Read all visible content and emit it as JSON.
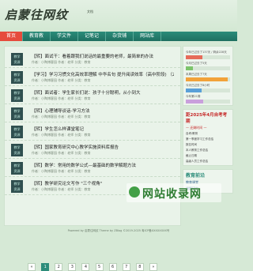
{
  "header": {
    "logo_text": "启蒙往网纹",
    "logo_sub": "文档"
  },
  "nav": {
    "items": [
      "首页",
      "教育教",
      "学文件",
      "记笔记",
      "杂货铺",
      "网站库"
    ],
    "active_index": 0
  },
  "articles": [
    {
      "badge": "教学\n资源",
      "title": "【转】面试干：看着跟我们说话的最重要的老师，最简单的办法",
      "meta": "作者：小陶博客园 作者：老师 分类：教育",
      "stamp": ""
    },
    {
      "badge": "教学\n资源",
      "title": "【学习】学习习惯文化高效率理解 中华名句 提升阅读效率（高中阶段) （2024—2025年）",
      "meta": "作者：小陶博客园 作者：老师 分类：教育",
      "stamp": ""
    },
    {
      "badge": "教学\n资源",
      "title": "【转】面试者：学生家长们说：孩子十分聪明，从小到大",
      "meta": "作者：小陶博客园 作者：老师 分类：教育",
      "stamp": ""
    },
    {
      "badge": "教学\n资源",
      "title": "【转】心理辅导谈话-学习方法",
      "meta": "作者：小陶博客园 作者：老师 分类：教育",
      "stamp": ""
    },
    {
      "badge": "教学\n资源",
      "title": "【转】学生怎么样课堂笔记",
      "meta": "作者：小陶博客园 作者：老师 分类：教育",
      "stamp": ""
    },
    {
      "badge": "教学\n资源",
      "title": "【转】国家教育研究中心教学实施资料库报告",
      "meta": "作者：小陶博客园 作者：老师 分类：教育",
      "stamp": ""
    },
    {
      "badge": "教学\n资源",
      "title": "【转】数学：常用的数学公式—最基础的数学解题方法",
      "meta": "作者：小陶博客园 作者：老师 分类：教育",
      "stamp": ""
    },
    {
      "badge": "教学\n资源",
      "title": "【转】教学研究论文写作 \"三个视角\"",
      "meta": "作者：小陶博客园 作者：老师 分类：教育",
      "stamp": ""
    }
  ],
  "pager": {
    "prev": "«",
    "pages": [
      "1",
      "2",
      "3",
      "4",
      "5",
      "6",
      "7",
      "8"
    ],
    "next": "»",
    "current": "1"
  },
  "sidebar": {
    "progress": [
      {
        "label": "今年已过去了137天 / 剩余228天",
        "value": 0.37,
        "color": "#e66b5a"
      },
      {
        "label": "今月已过去了5天",
        "value": 0.16,
        "color": "#7cc46b"
      },
      {
        "label": "本周已过去了7天",
        "value": 0.95,
        "color": "#f2a23a"
      },
      {
        "label": "今天已过去了8小时",
        "value": 0.35,
        "color": "#5aa0d8"
      },
      {
        "label": "今年第21周",
        "value": 0.4,
        "color": "#c9a0dc"
      }
    ],
    "promo_title": "距2025年4月自考考期",
    "promo_sub": "— 还剩时间 —",
    "promo_items": [
      "自考/教育",
      "第一季度学习工作总结",
      "报名时间",
      "本人教育工作总结",
      "截止日期",
      "高级人员工作总结"
    ],
    "tags_title": "教育前沿",
    "tags": [
      "教育课堂",
      "课题研究"
    ]
  },
  "watermark": {
    "text": "网站收录网"
  },
  "footer": {
    "text": "Powered by 启蒙往网纹 Theme by ZBlog ©2019-2025 粤ICP备XXXXXXXX号"
  }
}
